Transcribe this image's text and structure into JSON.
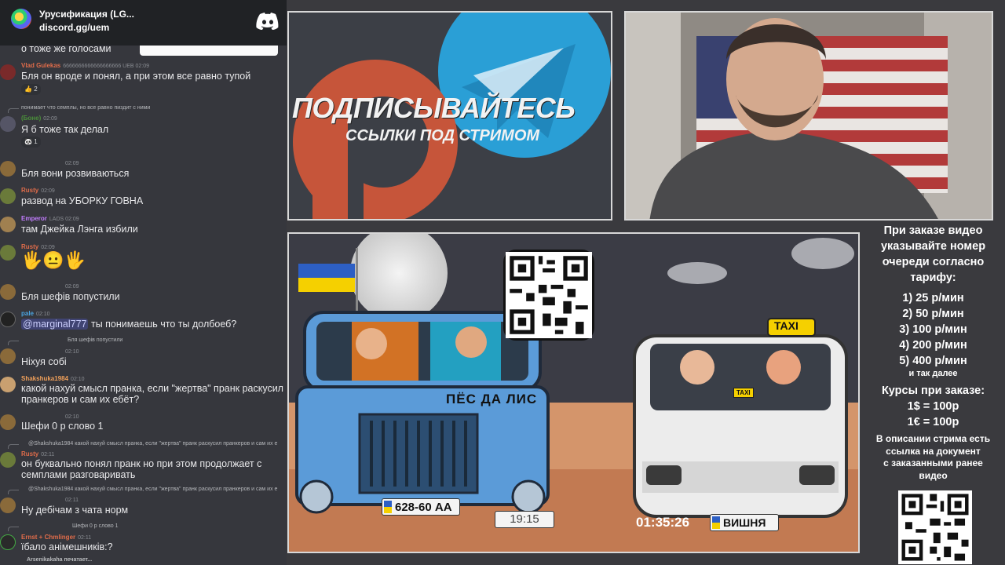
{
  "discord": {
    "server_name": "Урусификация (LG...",
    "invite": "discord.gg/uem"
  },
  "chat": {
    "top_fragment": "о тоже же голосами",
    "messages": [
      {
        "user": "Vlad Gulekas",
        "meta": "6666666666666666666 UEB 02:09",
        "text": "Бля он вроде и понял, а при этом все равно тупой",
        "reaction": "2"
      },
      {
        "reply": "понимает что семплы, но все равно пиздит с ними",
        "user": "(Боне)",
        "meta": "02:09",
        "text": "Я б тоже так делал",
        "reaction": "1"
      },
      {
        "user": "",
        "meta": "02:09",
        "text": "Бля вони розвиваються"
      },
      {
        "user": "Rusty",
        "meta": "02:09",
        "text": "развод на УБОРКУ ГОВНА"
      },
      {
        "user": "Emperor",
        "meta": "LADS 02:09",
        "text": "там Джейка Лэнга избили"
      },
      {
        "user": "Rusty",
        "meta": "02:09",
        "emoji": "🖐😐🖐"
      },
      {
        "user": "",
        "meta": "02:09",
        "text": "Бля шефів попустили"
      },
      {
        "user": "pale",
        "meta": "02:10",
        "mention": "@marginal777",
        "text": "ты понимаешь что ты долбоеб?"
      },
      {
        "reply": "Бля шефів попустили",
        "user": "",
        "meta": "02:10",
        "text": "Ніхуя собі"
      },
      {
        "user": "Shakshuka1984",
        "meta": "02:10",
        "text": "какой нахуй смысл пранка, если \"жертва\" пранк раскусил пранкеров и сам их ебёт?"
      },
      {
        "user": "",
        "meta": "02:10",
        "text": "Шефи 0 р слово 1"
      },
      {
        "reply": "@Shakshuka1984 какой нахуй смысл пранка, если \"жертва\" пранк раскусил пранкеров и сам их е",
        "user": "Rusty",
        "meta": "02:11",
        "text": "он буквально понял пранк но при этом продолжает с семплами разговаривать"
      },
      {
        "reply": "@Shakshuka1984 какой нахуй смысл пранка, если \"жертва\" пранк раскусил пранкеров и сам их е",
        "user": "",
        "meta": "02:11",
        "text": "Ну дебічам з чата норм"
      },
      {
        "reply": "Шефи 0 р слово 1",
        "user": "Ernst + Chmlinger",
        "meta": "02:11",
        "text": "їбало анімешників:?"
      }
    ],
    "typing": "Arsenikakaha печатает..."
  },
  "promo": {
    "line1": "ПОДПИСЫВАЙТЕСЬ",
    "line2": "ССЫЛКИ ПОД СТРИМОМ"
  },
  "video": {
    "truck_text": "ПЁС ДА ЛИС",
    "plate_left": "628-60 АА",
    "time_left": "19:15",
    "timer_right": "01:35:26",
    "plate_right": "ВИШНЯ",
    "taxi_sign": "TAXI",
    "taxi_small": "TAXI"
  },
  "info": {
    "heading": [
      "При заказе видео",
      "указывайте номер",
      "очереди согласно",
      "тарифу:"
    ],
    "tariffs": [
      "1) 25 р/мин",
      "2) 50 р/мин",
      "3) 100 р/мин",
      "4) 200 р/мин",
      "5) 400 р/мин"
    ],
    "etc": "и так далее",
    "courses_title": "Курсы при заказе:",
    "courses": [
      "1$ = 100р",
      "1€ = 100р"
    ],
    "desc": [
      "В описании стрима есть",
      "ссылка на документ",
      "с заказанными ранее",
      "видео"
    ]
  },
  "colors": {
    "chat_bg": "#36373d",
    "blurple": "#5865f2",
    "rusty": "#e06c4a",
    "emperor": "#c27dff",
    "shakshuka": "#f0a05a",
    "green_user": "#4a8f3a"
  }
}
